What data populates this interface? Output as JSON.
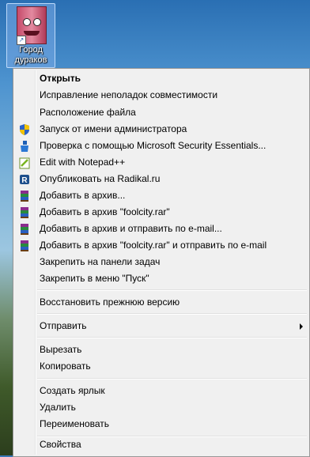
{
  "desktop": {
    "icon_label_line1": "Город",
    "icon_label_line2": "дураков"
  },
  "menu": {
    "items": [
      {
        "label": "Открыть",
        "bold": true
      },
      {
        "label": "Исправление неполадок совместимости"
      },
      {
        "label": "Расположение файла"
      },
      {
        "label": "Запуск от имени администратора",
        "icon": "uac-shield-icon"
      },
      {
        "label": "Проверка с помощью Microsoft Security Essentials...",
        "icon": "security-essentials-icon"
      },
      {
        "label": "Edit with Notepad++",
        "icon": "notepadpp-icon"
      },
      {
        "label": "Опубликовать на Radikal.ru",
        "icon": "radikal-icon"
      },
      {
        "label": "Добавить в архив...",
        "icon": "winrar-icon"
      },
      {
        "label": "Добавить в архив \"foolcity.rar\"",
        "icon": "winrar-icon"
      },
      {
        "label": "Добавить в архив и отправить по e-mail...",
        "icon": "winrar-icon"
      },
      {
        "label": "Добавить в архив \"foolcity.rar\" и отправить по e-mail",
        "icon": "winrar-icon"
      },
      {
        "label": "Закрепить на панели задач"
      },
      {
        "label": "Закрепить в меню \"Пуск\""
      },
      {
        "label": "Восстановить прежнюю версию"
      },
      {
        "label": "Отправить",
        "submenu": true
      },
      {
        "label": "Вырезать"
      },
      {
        "label": "Копировать"
      },
      {
        "label": "Создать ярлык"
      },
      {
        "label": "Удалить"
      },
      {
        "label": "Переименовать"
      },
      {
        "label": "Свойства"
      }
    ]
  }
}
